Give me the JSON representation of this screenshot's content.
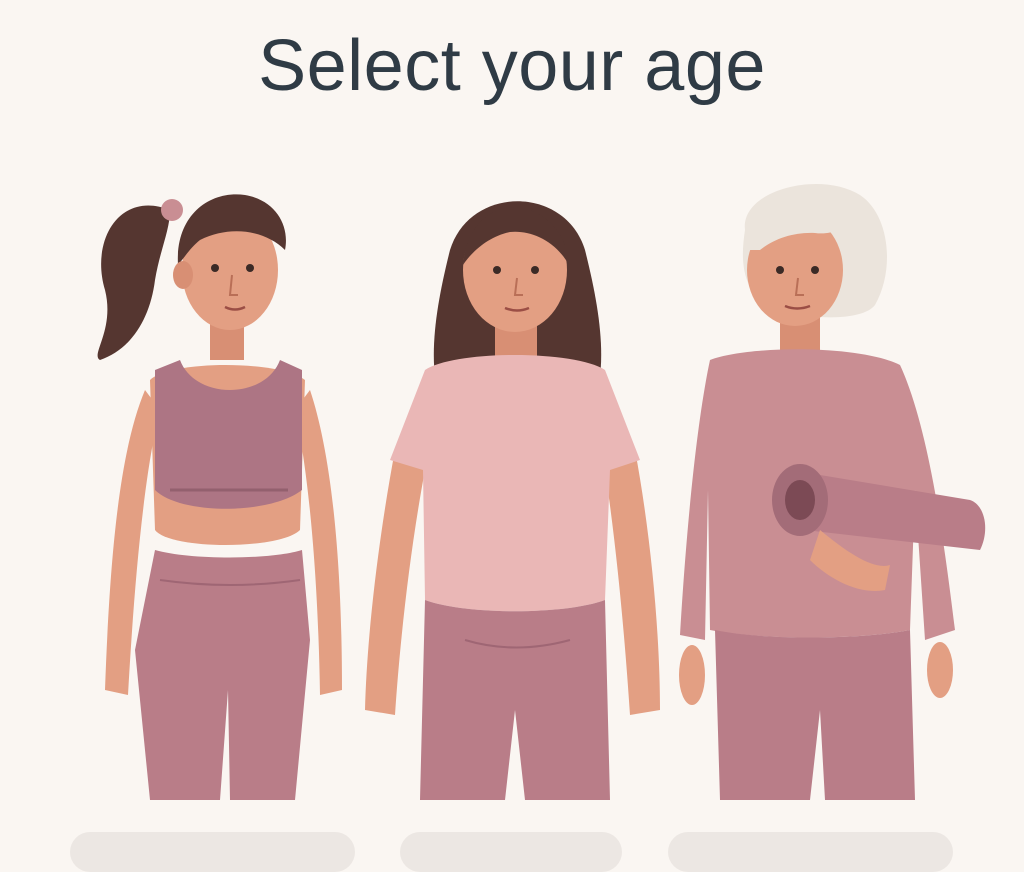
{
  "page": {
    "title": "Select your age"
  },
  "options": [
    {
      "id": "young",
      "icon": "young-woman-figure-icon"
    },
    {
      "id": "middle",
      "icon": "middle-aged-woman-figure-icon"
    },
    {
      "id": "senior",
      "icon": "senior-woman-yoga-mat-figure-icon"
    }
  ],
  "colors": {
    "background": "#faf6f2",
    "title": "#2f3b45",
    "outfit_mauve": "#b97d88",
    "outfit_pink": "#eab7b6",
    "skin": "#e39f83",
    "hair_dark": "#553630",
    "hair_gray": "#ebe4dc"
  }
}
